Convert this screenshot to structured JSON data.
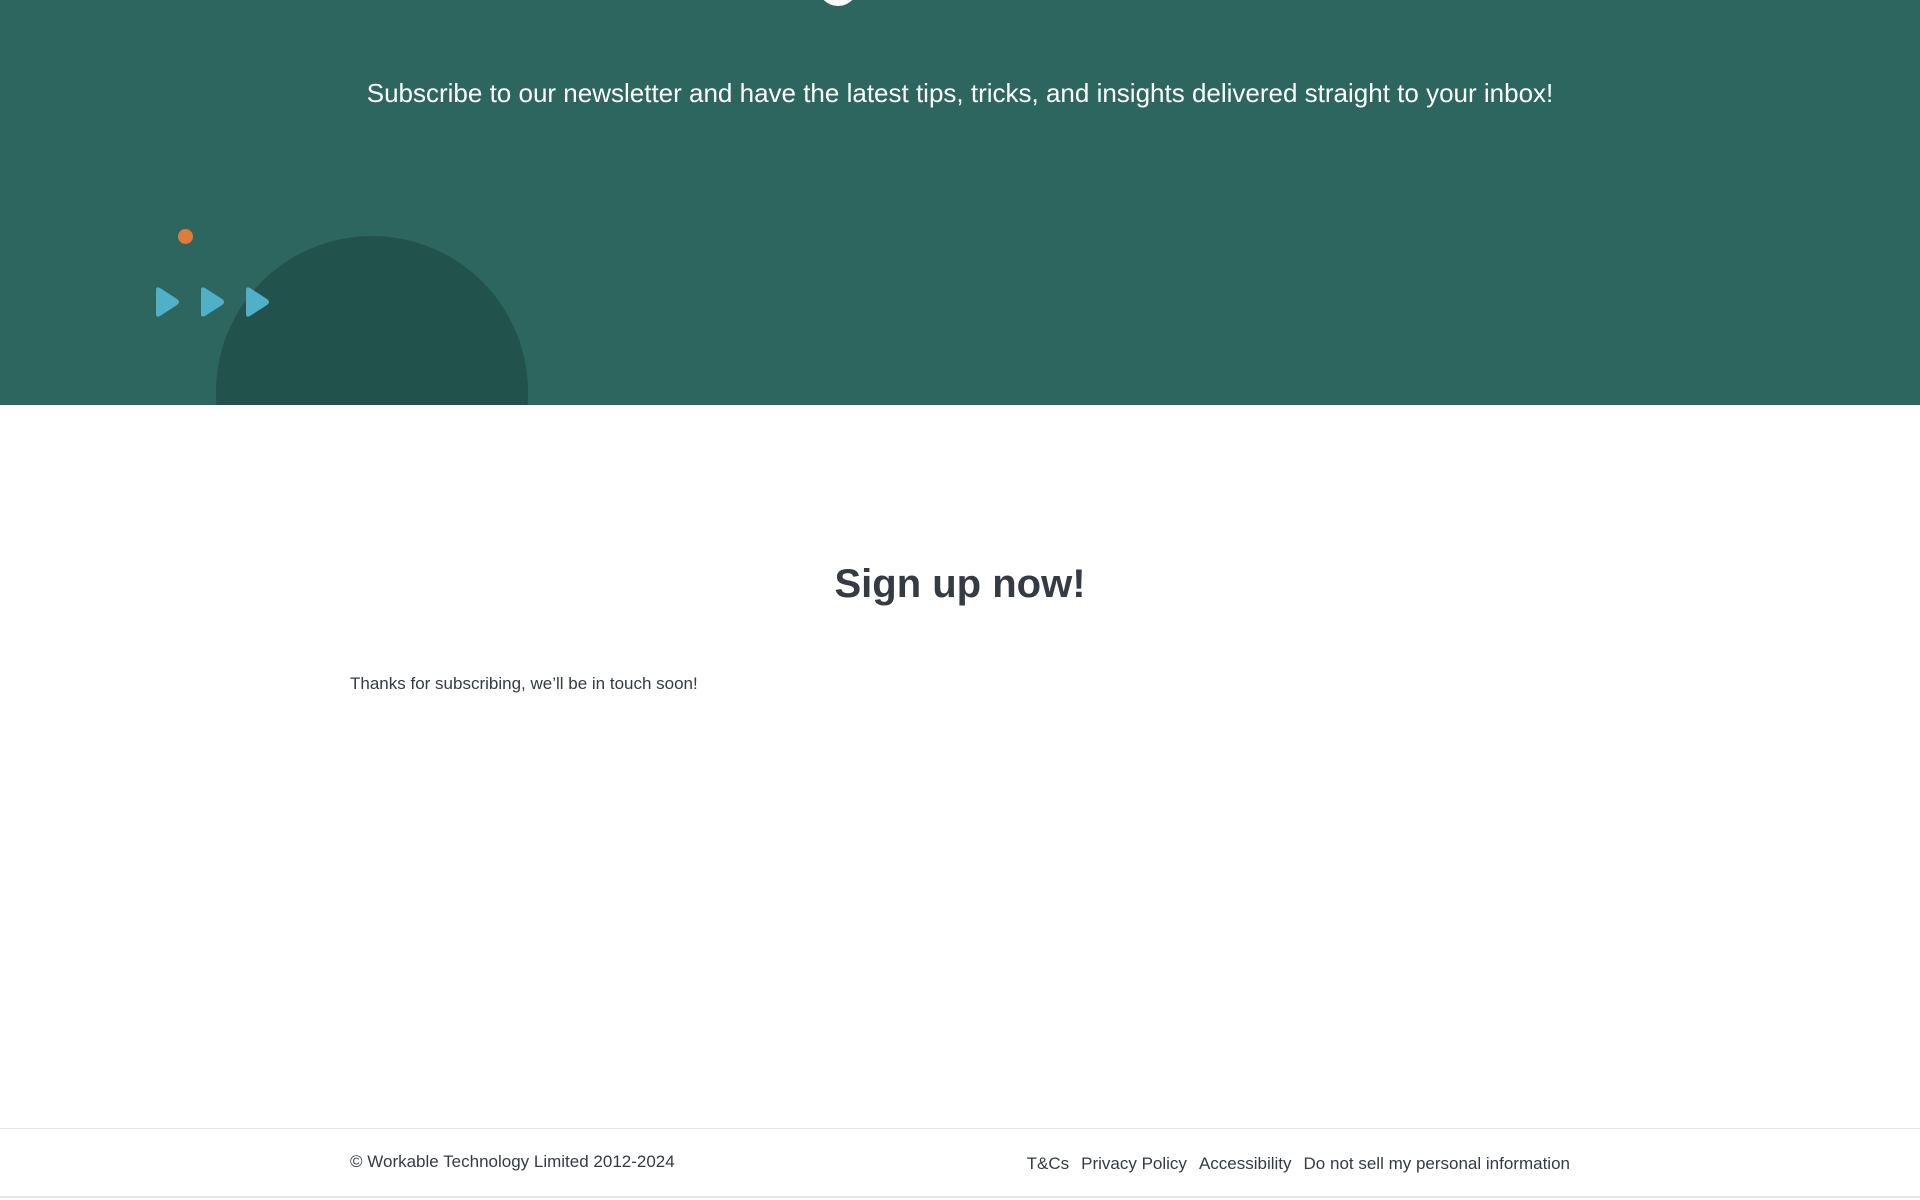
{
  "hero": {
    "subtitle": "Subscribe to our newsletter and have the latest tips, tricks, and insights delivered straight to your inbox!"
  },
  "main": {
    "heading": "Sign up now!",
    "confirmation": "Thanks for subscribing, we’ll be in touch soon!"
  },
  "footer": {
    "copyright": "© Workable Technology Limited 2012-2024",
    "links": [
      {
        "label": "T&Cs"
      },
      {
        "label": "Privacy Policy"
      },
      {
        "label": "Accessibility"
      },
      {
        "label": "Do not sell my personal information"
      }
    ]
  },
  "colors": {
    "hero_bg": "#2c665f",
    "hero_circle": "#22524c",
    "accent_dot": "#e07b3b",
    "arrow_blue": "#4fb0c8",
    "text_dark": "#353b44"
  }
}
